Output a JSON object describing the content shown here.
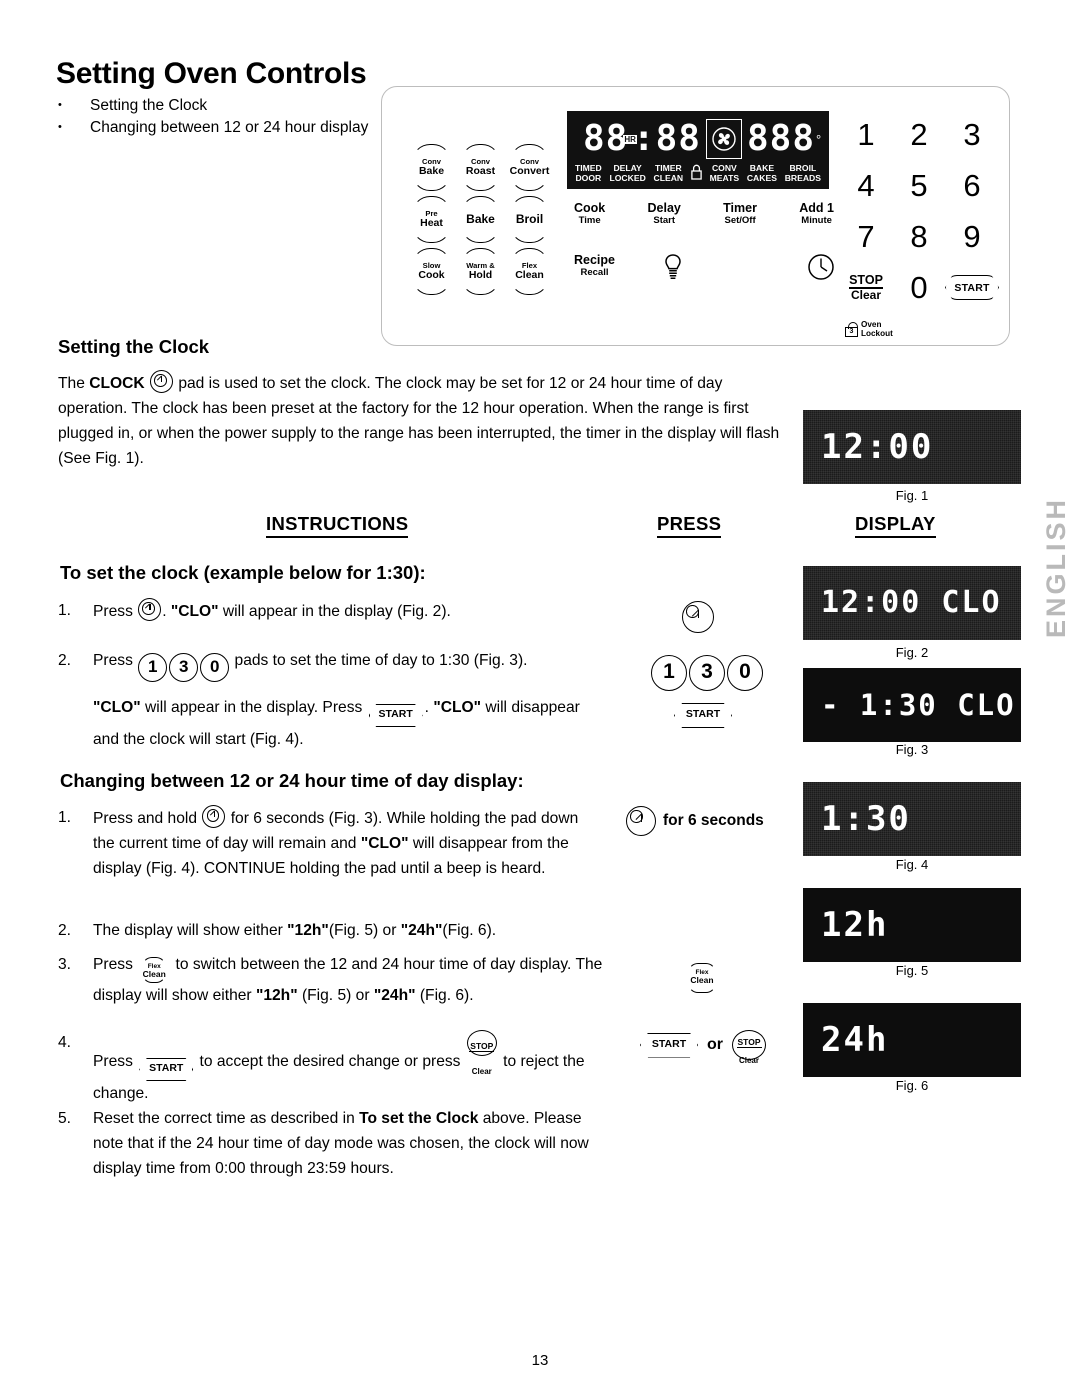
{
  "page": {
    "title": "Setting Oven Controls",
    "number": "13",
    "side_tab": "ENGLISH"
  },
  "intro_bullets": [
    "Setting the Clock",
    "Changing between 12 or 24 hour display"
  ],
  "control_panel": {
    "pads": [
      [
        {
          "line1": "Conv",
          "line2": "Bake"
        },
        {
          "line1": "Conv",
          "line2": "Roast"
        },
        {
          "line1": "Conv",
          "line2": "Convert"
        }
      ],
      [
        {
          "line1": "Pre",
          "line2": "Heat"
        },
        {
          "line1": "",
          "line2": "Bake"
        },
        {
          "line1": "",
          "line2": "Broil"
        }
      ],
      [
        {
          "line1": "Slow",
          "line2": "Cook"
        },
        {
          "line1": "Warm &",
          "line2": "Hold"
        },
        {
          "line1": "Flex",
          "line2": "Clean"
        }
      ]
    ],
    "display": {
      "time_left": "88",
      "hr_tag": "HR",
      "colon": ":",
      "time_right": "88",
      "temp": "888",
      "degree": "°",
      "fan_icon": "convection-fan-icon",
      "annunciators": [
        {
          "top": "TIMED",
          "bottom": "DOOR"
        },
        {
          "top": "DELAY",
          "bottom": "LOCKED"
        },
        {
          "top": "TIMER",
          "bottom": "CLEAN"
        },
        {
          "top": "",
          "bottom": "lock-icon"
        },
        {
          "top": "CONV",
          "bottom": "MEATS"
        },
        {
          "top": "BAKE",
          "bottom": "CAKES"
        },
        {
          "top": "BROIL",
          "bottom": "BREADS"
        }
      ]
    },
    "function_keys": [
      {
        "line1": "Cook",
        "line2": "Time"
      },
      {
        "line1": "Delay",
        "line2": "Start"
      },
      {
        "line1": "Timer",
        "line2": "Set/Off"
      },
      {
        "line1": "Add 1",
        "line2": "Minute"
      }
    ],
    "function_keys_row2": [
      {
        "line1": "Recipe",
        "line2": "Recall"
      },
      {
        "icon": "light-bulb-icon"
      },
      {
        "icon": ""
      },
      {
        "icon": "clock-icon"
      }
    ],
    "keypad": {
      "rows": [
        [
          "1",
          "2",
          "3"
        ],
        [
          "4",
          "5",
          "6"
        ],
        [
          "7",
          "8",
          "9"
        ]
      ],
      "stop_line1": "STOP",
      "stop_line2": "Clear",
      "zero": "0",
      "start": "START",
      "lockout_digit": "3",
      "lockout_line1": "Oven",
      "lockout_line2": "Lockout"
    }
  },
  "sections": {
    "setting_clock_heading": "Setting the Clock",
    "setting_clock_para_a": "The ",
    "setting_clock_bold": "CLOCK",
    "setting_clock_para_b": " pad is used to set the clock. The clock may be set for 12 or 24 hour time of day operation.  The clock has been preset at the factory for the 12 hour operation.  When the range is first plugged in, or when the power supply to the range has been interrupted, the timer in the display will flash (See Fig. 1).",
    "col_instructions": "INSTRUCTIONS",
    "col_press": "PRESS",
    "col_display": "DISPLAY",
    "set_clock_heading": "To set the clock (example below for 1:30):",
    "step1_num": "1.",
    "step1_a": "Press ",
    "step1_b": ".  ",
    "step1_quote": "\"CLO\"",
    "step1_c": " will appear in the display (Fig. 2).",
    "step2_num": "2.",
    "step2_a": "Press ",
    "step2_digits": [
      "1",
      "3",
      "0"
    ],
    "step2_b": " pads to set the time of day to 1:30 (Fig. 3).",
    "step2_line2_quote1": "\"CLO\"",
    "step2_line2_a": " will appear in the display.  Press ",
    "step2_line2_start": "START",
    "step2_line2_b": ". ",
    "step2_line2_quote2": "\"CLO\"",
    "step2_line2_c": " will disappear and the clock will start (Fig. 4).",
    "changing_heading": "Changing between 12 or 24 hour time of day display:",
    "c_step1_num": "1.",
    "c_step1_a": "Press and hold ",
    "c_step1_b": " for 6 seconds (Fig. 3). While holding the pad down the current time of day will remain and ",
    "c_step1_quote": "\"CLO\"",
    "c_step1_c": " will disappear from the display (Fig. 4). CONTINUE holding the pad until a beep is heard.",
    "c_step2_num": "2.",
    "c_step2_a": "The display will show either ",
    "c_step2_q1": "\"12h\"",
    "c_step2_b": "(Fig. 5) or ",
    "c_step2_q2": "\"24h\"",
    "c_step2_c": "(Fig. 6).",
    "c_step3_num": "3.",
    "c_step3_a": "Press ",
    "c_step3_b": " to switch between the 12 and 24 hour time of day display. The display will show either ",
    "c_step3_q1": "\"12h\"",
    "c_step3_c": " (Fig. 5) or ",
    "c_step3_q2": "\"24h\"",
    "c_step3_d": " (Fig. 6).",
    "c_step4_num": "4.",
    "c_step4_a": "Press ",
    "c_step4_start": "START",
    "c_step4_b": " to accept the desired change or press ",
    "c_step4_c": " to reject the change.",
    "c_step5_num": "5.",
    "c_step5_a": "Reset the correct time as described in ",
    "c_step5_bold": "To set the Clock",
    "c_step5_b": " above. Please note that if the 24 hour time of day mode was chosen, the clock will now display time from 0:00 through 23:59 hours."
  },
  "press_column": {
    "clock_icon": "clock-pad-icon",
    "digits": [
      "1",
      "3",
      "0"
    ],
    "start_label": "START",
    "hold_label": "for 6 seconds",
    "flex_line1": "Flex",
    "flex_line2": "Clean",
    "or_label": "or",
    "stop_line1": "STOP",
    "stop_line2": "Clear"
  },
  "display_column": {
    "figures": [
      {
        "caption": "Fig. 1",
        "readout": "12:00",
        "noisy": true
      },
      {
        "caption": "Fig. 2",
        "readout": "12:00 CLO",
        "noisy": true
      },
      {
        "caption": "Fig. 3",
        "readout": "- 1:30 CLO",
        "noisy": false
      },
      {
        "caption": "Fig. 4",
        "readout": "1:30",
        "noisy": true
      },
      {
        "caption": "Fig. 5",
        "readout": "12h",
        "noisy": false
      },
      {
        "caption": "Fig. 6",
        "readout": "24h",
        "noisy": false
      }
    ]
  }
}
